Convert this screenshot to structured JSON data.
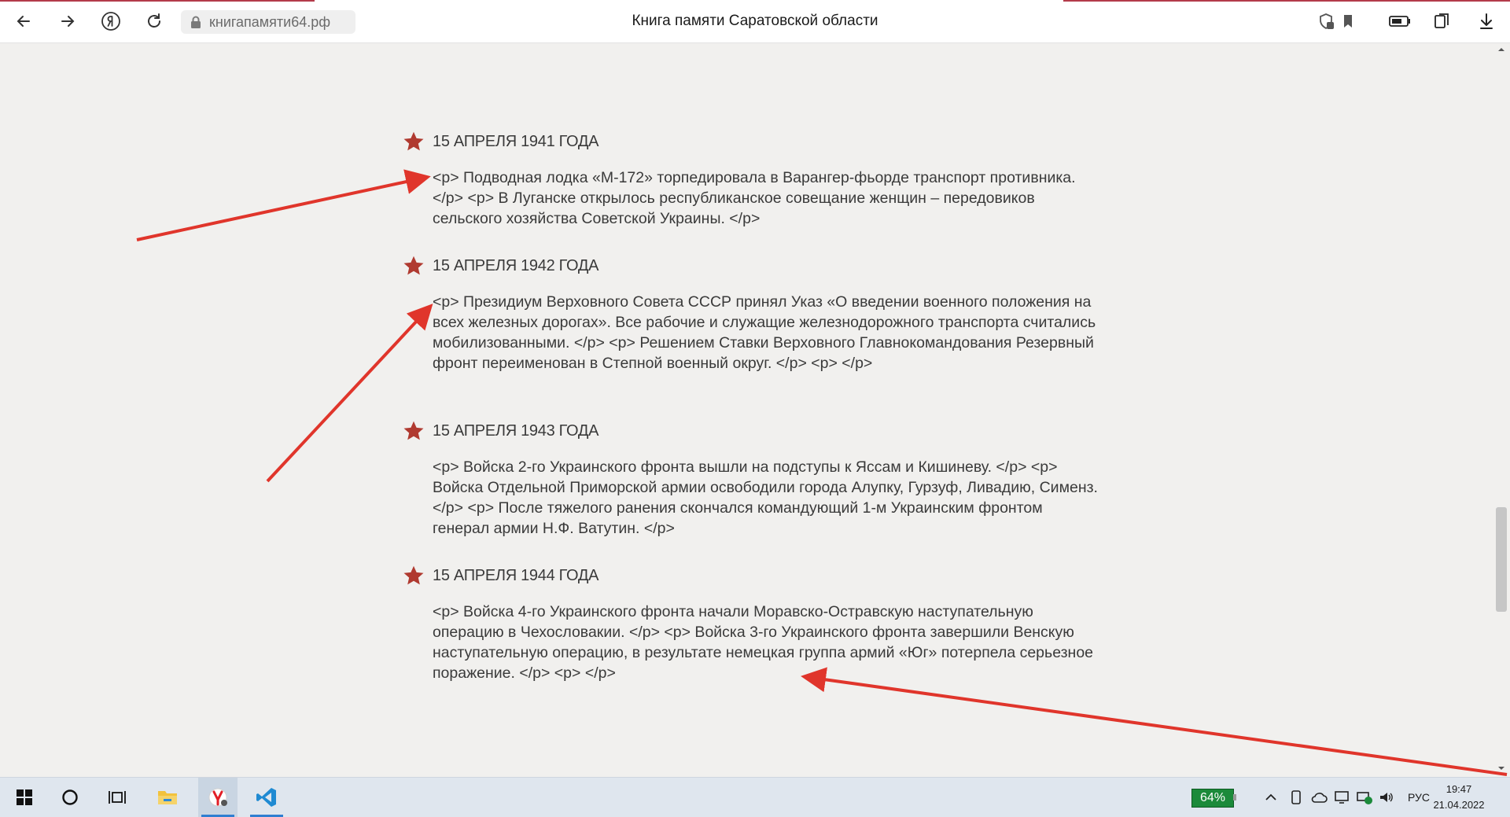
{
  "browser": {
    "url": "книгапамяти64.рф",
    "page_title": "Книга памяти Саратовской области"
  },
  "entries": [
    {
      "date": "15 АПРЕЛЯ 1941 ГОДА",
      "text": "<p> Подводная лодка «М-172» торпедировала в Варангер-фьорде транспорт противника. </p> <p> В Луганске открылось республиканское совещание женщин – передовиков сельского хозяйства Советской Украины. </p>"
    },
    {
      "date": "15 АПРЕЛЯ 1942 ГОДА",
      "text": "<p> Президиум Верховного Совета СССР принял Указ «О введении военного положения на всех железных дорогах». Все рабочие и служащие железнодорожного транспорта считались мобилизованными. </p> <p> Решением Ставки Верховного Главнокомандования Резервный фронт переименован в Степной военный округ. </p> <p>   </p>"
    },
    {
      "date": "15 АПРЕЛЯ 1943 ГОДА",
      "text": "<p> Войска 2-го Украинского фронта вышли на подступы к Яссам и Кишиневу. </p> <p> Войска Отдельной Приморской армии освободили города Алупку, Гурзуф, Ливадию, Сименз. </p> <p> После тяжелого ранения скончался командующий 1-м Украинским фронтом генерал армии Н.Ф. Ватутин. </p>"
    },
    {
      "date": "15 АПРЕЛЯ 1944 ГОДА",
      "text": "<p> Войска 4-го Украинского фронта начали Моравско-Остравскую наступательную операцию в Чехословакии. </p> <p> Войска 3-го Украинского фронта завершили Венскую наступательную операцию, в результате немецкая группа армий «Юг» потерпела серьезное поражение. </p> <p>   </p>"
    }
  ],
  "taskbar": {
    "battery": "64%",
    "language": "РУС",
    "time": "19:47",
    "date": "21.04.2022"
  },
  "colors": {
    "star": "#b03a30",
    "annotation_arrow": "#e0352b",
    "page_bg": "#f1f0ee"
  }
}
